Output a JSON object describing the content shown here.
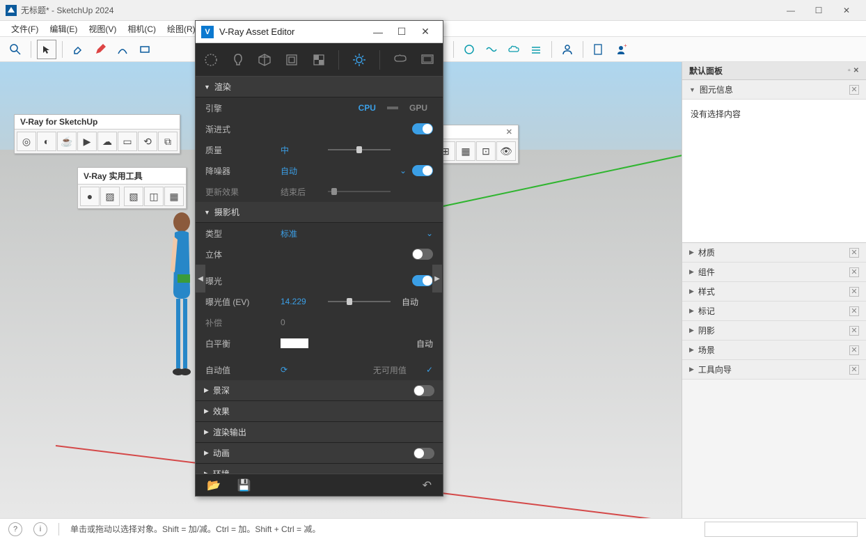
{
  "window": {
    "title": "无标题* - SketchUp 2024"
  },
  "menubar": {
    "items": [
      "文件(F)",
      "编辑(E)",
      "视图(V)",
      "相机(C)",
      "绘图(R)"
    ]
  },
  "float_toolbars": {
    "vray_main": {
      "title": "V-Ray for SketchUp"
    },
    "vray_util": {
      "title": "V-Ray 实用工具"
    }
  },
  "vray_dialog": {
    "title": "V-Ray Asset Editor",
    "sections": {
      "render": {
        "title": "渲染",
        "engine_label": "引擎",
        "engine_cpu": "CPU",
        "engine_gpu": "GPU",
        "progressive_label": "渐进式",
        "quality_label": "质量",
        "quality_value": "中",
        "denoiser_label": "降噪器",
        "denoiser_value": "自动",
        "update_label": "更新效果",
        "update_value": "结束后"
      },
      "camera": {
        "title": "摄影机",
        "type_label": "类型",
        "type_value": "标准",
        "stereo_label": "立体",
        "exposure_label": "曝光",
        "ev_label": "曝光值 (EV)",
        "ev_value": "14.229",
        "ev_auto": "自动",
        "compensation_label": "补偿",
        "compensation_value": "0",
        "wb_label": "白平衡",
        "wb_auto": "自动",
        "auto_label": "自动值",
        "auto_value": "无可用值"
      },
      "dof": {
        "title": "景深"
      },
      "effects": {
        "title": "效果"
      },
      "output": {
        "title": "渲染输出"
      },
      "animation": {
        "title": "动画"
      },
      "environment": {
        "title": "环境"
      }
    }
  },
  "right_panel": {
    "header": "默认面板",
    "entity_info": {
      "title": "图元信息",
      "body": "没有选择内容"
    },
    "sections": [
      {
        "title": "材质"
      },
      {
        "title": "组件"
      },
      {
        "title": "样式"
      },
      {
        "title": "标记"
      },
      {
        "title": "阴影"
      },
      {
        "title": "场景"
      },
      {
        "title": "工具向导"
      }
    ]
  },
  "status_bar": {
    "hint": "单击或拖动以选择对象。Shift = 加/减。Ctrl = 加。Shift + Ctrl = 减。"
  }
}
